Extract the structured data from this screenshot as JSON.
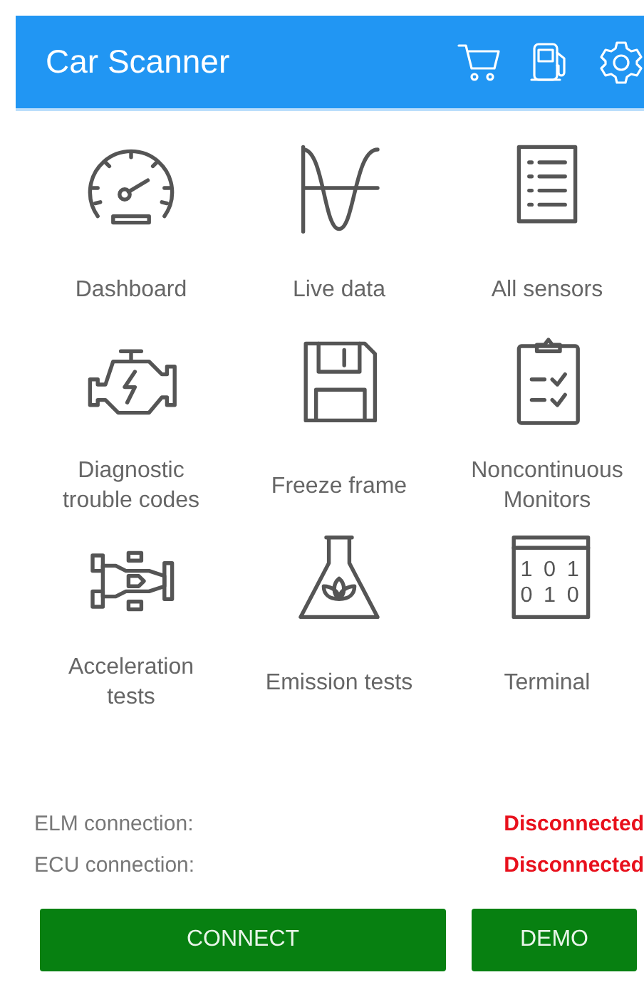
{
  "app_bar": {
    "title": "Car Scanner",
    "actions": [
      {
        "kind": "cart"
      },
      {
        "kind": "fuel"
      },
      {
        "kind": "settings"
      }
    ]
  },
  "menu": [
    {
      "label": "Dashboard",
      "kind": "gauge"
    },
    {
      "label": "Live data",
      "kind": "wave"
    },
    {
      "label": "All sensors",
      "kind": "list"
    },
    {
      "label": "Diagnostic trouble codes",
      "kind": "engine"
    },
    {
      "label": "Freeze frame",
      "kind": "floppy"
    },
    {
      "label": "Noncontinuous Monitors",
      "kind": "clipboard"
    },
    {
      "label": "Acceleration tests",
      "kind": "racecar"
    },
    {
      "label": "Emission tests",
      "kind": "flask"
    },
    {
      "label": "Terminal",
      "kind": "terminal",
      "icon_text": [
        "1 0 1",
        "0 1 0"
      ]
    }
  ],
  "status": [
    {
      "label": "ELM connection:",
      "value": "Disconnected",
      "connected": false
    },
    {
      "label": "ECU connection:",
      "value": "Disconnected",
      "connected": false
    }
  ],
  "buttons": [
    {
      "label": "CONNECT",
      "kind": "connect"
    },
    {
      "label": "DEMO",
      "kind": "demo"
    }
  ]
}
